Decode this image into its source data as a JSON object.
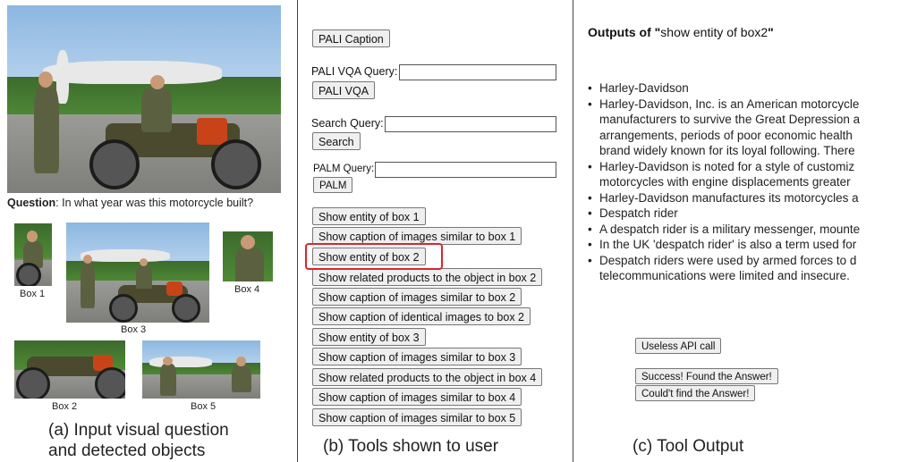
{
  "panel_a": {
    "question_label": "Question",
    "question_text": ": In what year was this motorcycle built?",
    "boxes": [
      "Box 1",
      "Box 2",
      "Box 3",
      "Box 4",
      "Box 5"
    ],
    "caption_line1": "(a) Input visual question",
    "caption_line2": "and detected objects"
  },
  "panel_b": {
    "pali_caption": "PALI Caption",
    "pali_vqa_label": "PALI VQA Query:",
    "pali_vqa_button": "PALI VQA",
    "search_label": "Search Query:",
    "search_button": "Search",
    "palm_label": "PALM Query:",
    "palm_button": "PALM",
    "tools": [
      "Show entity of box 1",
      "Show caption of images similar to box 1",
      "Show entity of box 2",
      "Show related products to the object in box 2",
      "Show caption of images similar to box 2",
      "Show caption of identical images to box 2",
      "Show entity of box 3",
      "Show caption of images similar to box 3",
      "Show related products to the object in box 4",
      "Show caption of images similar to box 4",
      "Show caption of images similar to box 5"
    ],
    "caption": "(b) Tools shown to user"
  },
  "panel_c": {
    "title_bold": "Outputs of \"",
    "title_query": "show entity of box2",
    "title_end": "\"",
    "results": [
      "Harley-Davidson",
      "Harley-Davidson, Inc. is an American motorcycle",
      "manufacturers to survive the Great Depression a",
      "arrangements, periods of poor economic health",
      "brand widely known for its loyal following. There",
      "Harley-Davidson is noted for a style of customiz",
      "motorcycles with engine displacements greater",
      "Harley-Davidson manufactures its motorcycles a",
      "Despatch rider",
      "A despatch rider is a military messenger, mounte",
      "In the UK 'despatch rider' is also a term used for",
      "Despatch riders were used by armed forces to d",
      "telecommunications were limited and insecure."
    ],
    "useless_button": "Useless API call",
    "success_button": "Success! Found the Answer!",
    "fail_button": "Could't find the Answer!",
    "caption": "(c) Tool Output"
  },
  "colors": {
    "highlight": "#d8262c"
  }
}
